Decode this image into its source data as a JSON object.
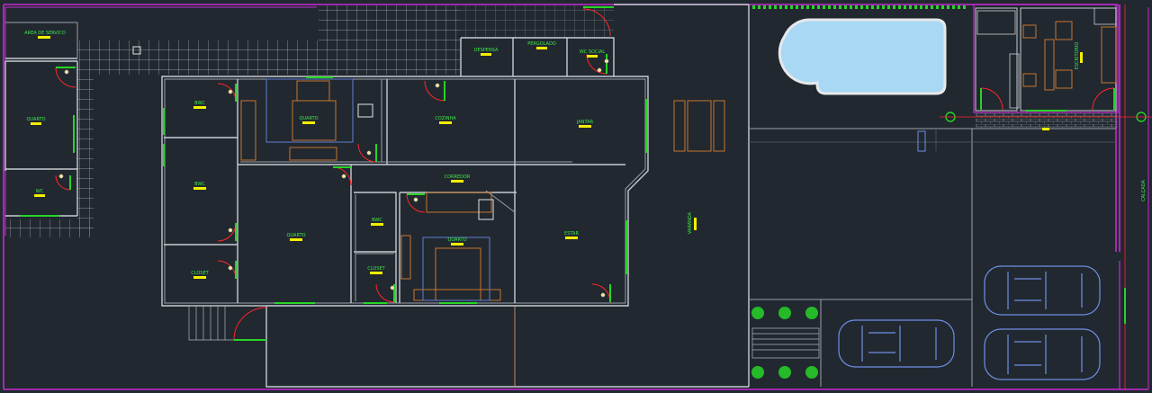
{
  "rooms": {
    "area_servico": "AREA DE SERVICO",
    "despensa": "DESPENSA",
    "pergolado": "PERGOLADO",
    "wc_social": "WC SOCIAL",
    "quarto_esq": "QUARTO",
    "wc_esq": "WC",
    "banho_1": "BWC",
    "quarto_1": "QUARTO",
    "cozinha": "COZINHA",
    "jantar": "JANTAR",
    "banho_2": "BWC",
    "corredor": "CORREDOR",
    "quarto_2": "QUARTO",
    "bwc_suite": "BWC",
    "quarto_suite": "QUARTO",
    "estar": "ESTAR",
    "closet_1": "CLOSET",
    "closet_2": "CLOSET",
    "varanda": "VARANDA",
    "escritorio": "ESCRITORIO",
    "calcada": "CALÇADA"
  },
  "colors": {
    "background": "#212830",
    "room_label": "#3fe84a",
    "label_tag": "#f4ee00",
    "wall": "#c8ccd2",
    "door_swing": "#ff2626",
    "door_leaf": "#27d427",
    "furniture": "#c8762e",
    "car_outline": "#6f8fe6",
    "pool_water": "#a9d8f5",
    "property_line": "#c42bd1"
  },
  "icons": [
    "door-swing-icon",
    "car-icon",
    "tree-icon",
    "pool-icon",
    "bed-icon",
    "desk-chair-icon",
    "elevation-marker-icon"
  ]
}
